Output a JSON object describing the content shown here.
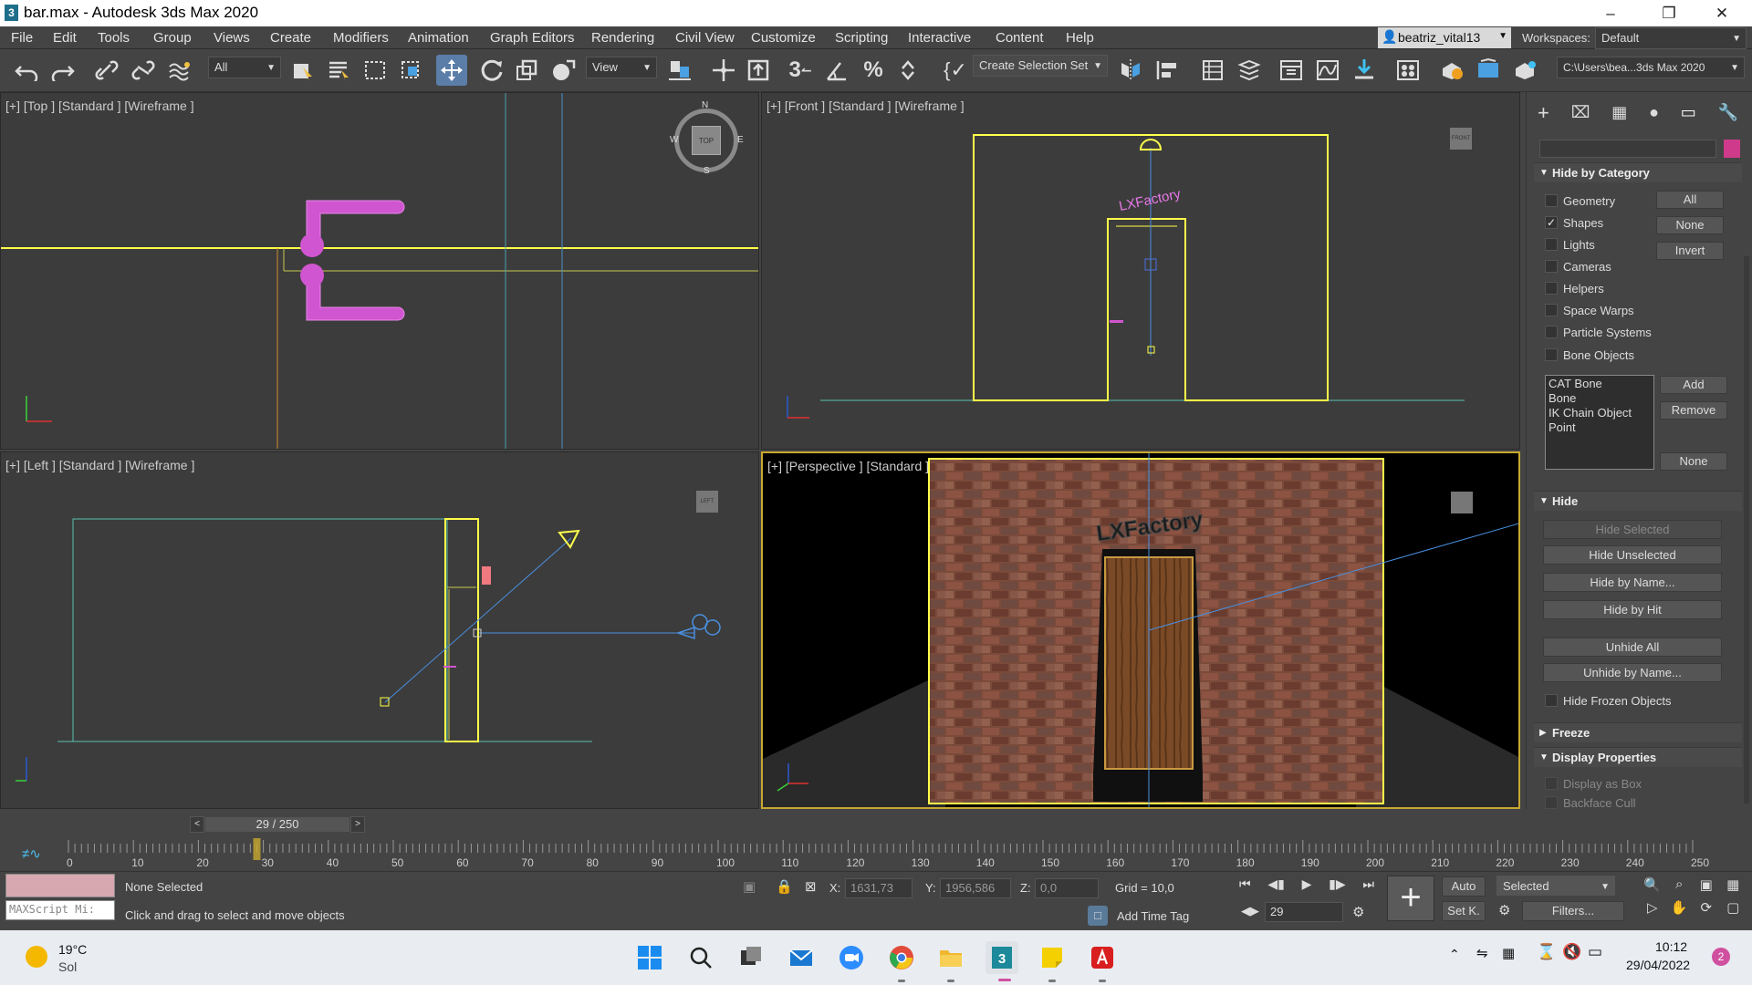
{
  "app": {
    "title": "bar.max - Autodesk 3ds Max 2020",
    "icon": "3ds-max-icon"
  },
  "menu": [
    "File",
    "Edit",
    "Tools",
    "Group",
    "Views",
    "Create",
    "Modifiers",
    "Animation",
    "Graph Editors",
    "Rendering",
    "Civil View",
    "Customize",
    "Scripting",
    "Interactive",
    "Content",
    "Help"
  ],
  "user": {
    "name": "beatriz_vital13",
    "workspaces_label": "Workspaces:",
    "workspace": "Default"
  },
  "toolbar": {
    "filter": "All",
    "ref_coord": "View",
    "selection_set": "Create Selection Set",
    "project_path": "C:\\Users\\bea...3ds Max 2020"
  },
  "viewports": {
    "top": {
      "label": "[+] [Top ] [Standard ] [Wireframe ]",
      "cube": "TOP",
      "compass": {
        "n": "N",
        "s": "S",
        "e": "E",
        "w": "W"
      }
    },
    "front": {
      "label": "[+] [Front ] [Standard ] [Wireframe ]",
      "cube": "FRONT",
      "sign": "LXFactory"
    },
    "left": {
      "label": "[+] [Left ] [Standard ] [Wireframe ]",
      "cube": "LEFT"
    },
    "persp": {
      "label": "[+] [Perspective ] [Standard ] [Default Shading ]",
      "sign": "LXFactory"
    }
  },
  "panel": {
    "hide_by_category": {
      "title": "Hide by Category",
      "items": [
        {
          "label": "Geometry",
          "checked": false
        },
        {
          "label": "Shapes",
          "checked": true
        },
        {
          "label": "Lights",
          "checked": false
        },
        {
          "label": "Cameras",
          "checked": false
        },
        {
          "label": "Helpers",
          "checked": false
        },
        {
          "label": "Space Warps",
          "checked": false
        },
        {
          "label": "Particle Systems",
          "checked": false
        },
        {
          "label": "Bone Objects",
          "checked": false
        }
      ],
      "all": "All",
      "none": "None",
      "invert": "Invert",
      "list": [
        "CAT Bone",
        "Bone",
        "IK Chain Object",
        "Point"
      ],
      "add": "Add",
      "remove": "Remove",
      "none2": "None"
    },
    "hide": {
      "title": "Hide",
      "hide_selected": "Hide Selected",
      "hide_unselected": "Hide Unselected",
      "hide_by_name": "Hide by Name...",
      "hide_by_hit": "Hide by Hit",
      "unhide_all": "Unhide All",
      "unhide_by_name": "Unhide by Name...",
      "hide_frozen": "Hide Frozen Objects"
    },
    "freeze": {
      "title": "Freeze"
    },
    "display_props": {
      "title": "Display Properties",
      "display_as_box": "Display as Box",
      "backface_cull": "Backface Cull"
    }
  },
  "timeline": {
    "frame": "29 / 250",
    "current": 29,
    "total": 250,
    "ticks": [
      "0",
      "10",
      "20",
      "30",
      "40",
      "50",
      "60",
      "70",
      "80",
      "90",
      "100",
      "110",
      "120",
      "130",
      "140",
      "150",
      "160",
      "170",
      "180",
      "190",
      "200",
      "210",
      "220",
      "230",
      "240",
      "250"
    ]
  },
  "status": {
    "maxscript": "MAXScript Mi:",
    "selection": "None Selected",
    "prompt": "Click and drag to select and move objects",
    "x_label": "X:",
    "x": "1631,73",
    "y_label": "Y:",
    "y": "1956,586",
    "z_label": "Z:",
    "z": "0,0",
    "grid": "Grid = 10,0",
    "add_time_tag": "Add Time Tag",
    "auto": "Auto",
    "setk": "Set K.",
    "selected": "Selected",
    "filters": "Filters...",
    "frame": "29"
  },
  "taskbar": {
    "temp": "19°C",
    "weather": "Sol",
    "time": "10:12",
    "date": "29/04/2022",
    "badge": "2"
  }
}
